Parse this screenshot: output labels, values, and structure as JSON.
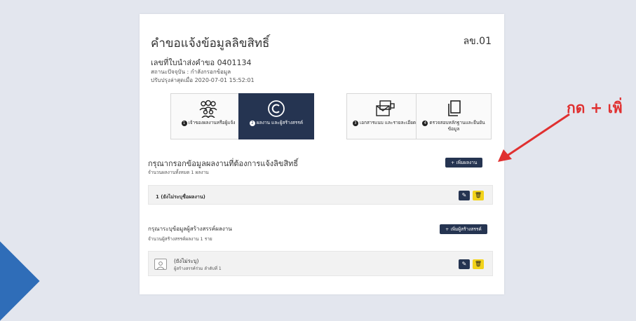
{
  "form": {
    "title": "คำขอแจ้งข้อมูลลิขสิทธิ์",
    "code": "ลข.01",
    "reference": "เลขที่ใบนำส่งคำขอ 0401134",
    "status": "สถานะปัจจุบัน : กำลังกรอกข้อมูล",
    "updated": "ปรับปรุงล่าสุดเมื่อ 2020-07-01 15:52:01"
  },
  "steps": [
    {
      "num": "1",
      "label": "เจ้าของผลงานหรือผู้แจ้ง",
      "icon": "people-icon",
      "active": false
    },
    {
      "num": "2",
      "label": "ผลงาน และผู้สร้างสรรค์",
      "icon": "copyright-icon",
      "active": true
    },
    {
      "num": "3",
      "label": "เอกสารแนบ และรายละเอียด",
      "icon": "documents-icon",
      "active": false
    },
    {
      "num": "4",
      "label": "ตรวจสอบหลักฐานและยืนยันข้อมูล",
      "icon": "copy-icon",
      "active": false
    }
  ],
  "works": {
    "title": "กรุณากรอกข้อมูลผลงานที่ต้องการแจ้งลิขสิทธิ์",
    "count_text": "จำนวนผลงานทั้งหมด 1 ผลงาน",
    "add_label": "+ เพิ่มผลงาน",
    "items": [
      {
        "text": "1 (ยังไม่ระบุชื่อผลงาน)"
      }
    ]
  },
  "creators": {
    "title": "กรุณาระบุข้อมูลผู้สร้างสรรค์ผลงาน",
    "count_text": "จำนวนผู้สร้างสรรค์ผลงาน 1 ราย",
    "add_label": "+ เพิ่มผู้สร้างสรรค์",
    "items": [
      {
        "name": "(ยังไม่ระบุ)",
        "meta": "ผู้สร้างสรรค์ร่วม ลำดับที่ 1"
      }
    ]
  },
  "annotation": {
    "text": "กด + เพิ่",
    "color": "#e03030"
  },
  "colors": {
    "primary": "#253451",
    "delete": "#f2d31b",
    "background": "#e3e6ee"
  }
}
